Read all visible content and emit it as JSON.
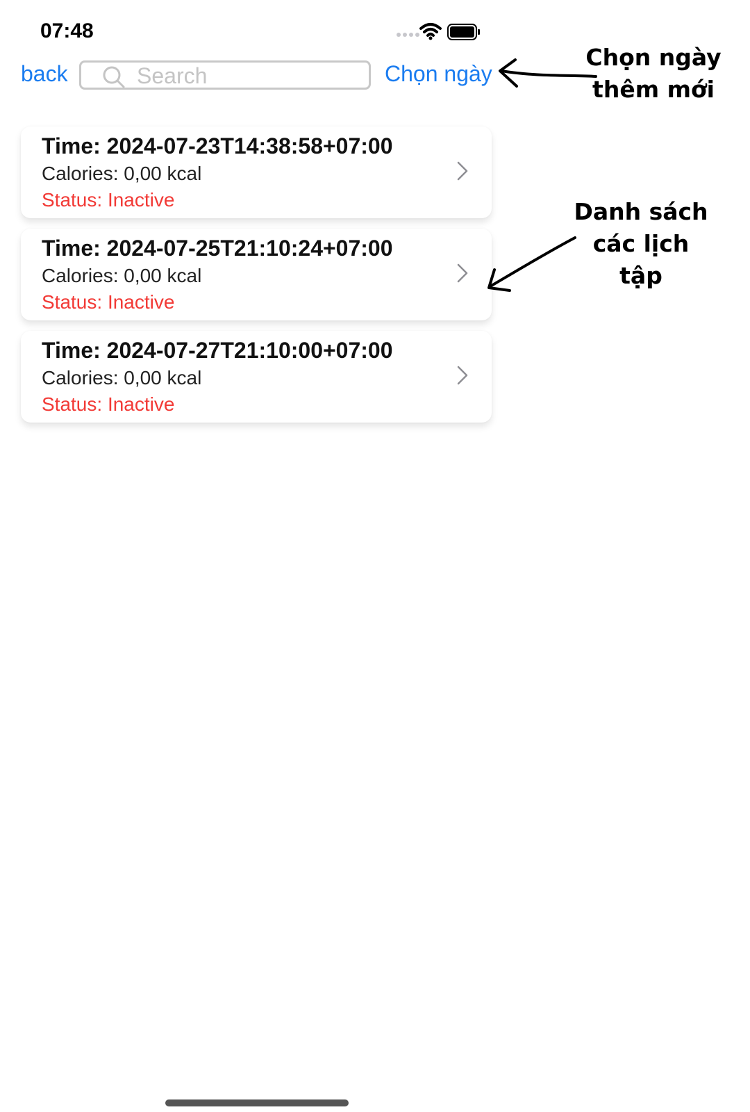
{
  "status_bar": {
    "time": "07:48"
  },
  "nav": {
    "back_label": "back",
    "search_placeholder": "Search",
    "search_value": "",
    "pick_date_label": "Chọn ngày"
  },
  "workouts": [
    {
      "time": "Time: 2024-07-23T14:38:58+07:00",
      "calories": "Calories: 0,00 kcal",
      "status": "Status: Inactive"
    },
    {
      "time": "Time: 2024-07-25T21:10:24+07:00",
      "calories": "Calories: 0,00 kcal",
      "status": "Status: Inactive"
    },
    {
      "time": "Time: 2024-07-27T21:10:00+07:00",
      "calories": "Calories: 0,00 kcal",
      "status": "Status: Inactive"
    }
  ],
  "annotations": {
    "pick_date_note_line1": "Chọn ngày",
    "pick_date_note_line2": "thêm mới",
    "list_note_line1": "Danh sách",
    "list_note_line2": "các lịch tập"
  },
  "colors": {
    "accent": "#1a7cf0",
    "status_inactive": "#f23a36"
  },
  "icons": {
    "signal": "signal-dots-icon",
    "wifi": "wifi-icon",
    "battery": "battery-icon",
    "search": "search-icon",
    "chevron": "chevron-right-icon"
  }
}
